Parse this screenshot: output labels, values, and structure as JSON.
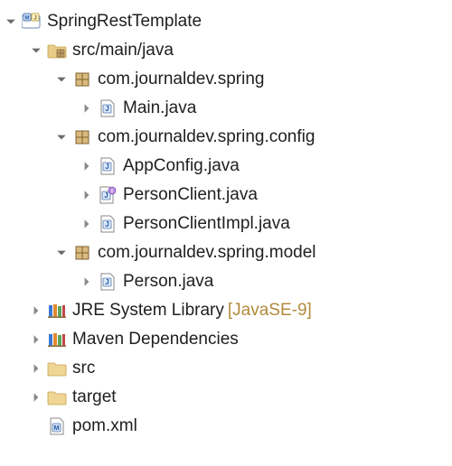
{
  "project": {
    "name": "SpringRestTemplate",
    "srcMainJava": "src/main/java",
    "packages": [
      {
        "name": "com.journaldev.spring",
        "files": [
          "Main.java"
        ]
      },
      {
        "name": "com.journaldev.spring.config",
        "files": [
          "AppConfig.java",
          "PersonClient.java",
          "PersonClientImpl.java"
        ]
      },
      {
        "name": "com.journaldev.spring.model",
        "files": [
          "Person.java"
        ]
      }
    ],
    "jre": {
      "label": "JRE System Library",
      "decor": "[JavaSE-9]"
    },
    "maven": "Maven Dependencies",
    "folders": [
      "src",
      "target"
    ],
    "pom": "pom.xml"
  },
  "icons": {
    "arrowDown": "▼",
    "arrowRight": "▶"
  }
}
